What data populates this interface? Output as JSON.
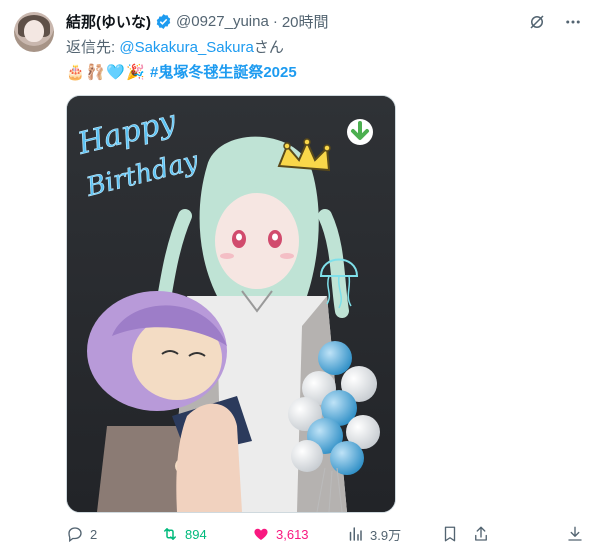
{
  "author": {
    "display_name": "結那(ゆいな)",
    "handle": "@0927_yuina",
    "separator": "·",
    "time": "20時間"
  },
  "reply": {
    "prefix": "返信先: ",
    "target": "@Sakakura_Sakura",
    "suffix": "さん"
  },
  "tweet_text": {
    "emojis": [
      "🎂",
      "🩰",
      "🩵",
      "🎉"
    ],
    "hashtag": "#鬼塚冬毬生誕祭2025"
  },
  "media": {
    "overlay_text_line1": "Happy",
    "overlay_text_line2": "Birthday"
  },
  "actions": {
    "replies": "2",
    "reposts": "894",
    "likes": "3,613",
    "views": "3.9万"
  },
  "colors": {
    "accent": "#1d9bf0",
    "repost": "#00ba7c",
    "like": "#f91880",
    "muted": "#536471"
  }
}
